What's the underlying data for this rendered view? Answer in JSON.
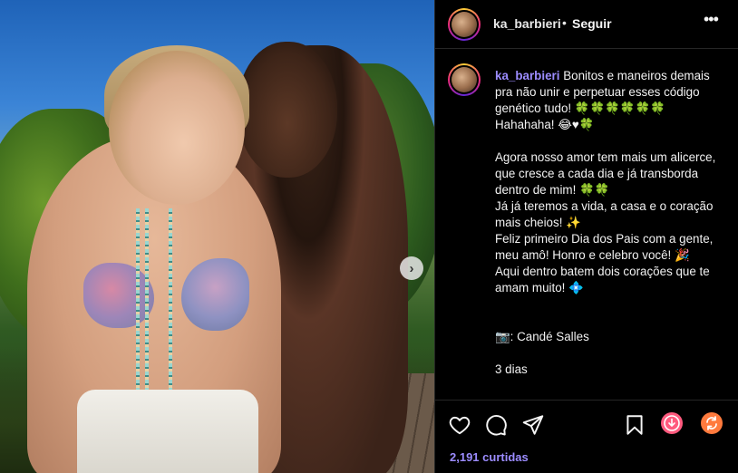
{
  "post": {
    "username": "ka_barbieri",
    "separator": "•",
    "follow_label": "Seguir",
    "more_label": "•••"
  },
  "caption": {
    "username": "ka_barbieri",
    "text": " Bonitos e maneiros demais pra não unir e perpetuar esses código genético tudo! 🍀🍀🍀🍀🍀🍀 Hahahaha! 😂♥🍀\n\nAgora nosso amor tem mais um alicerce, que cresce a cada dia e já transborda dentro de mim! 🍀🍀\nJá já teremos a vida, a casa e o coração mais cheios! ✨\nFeliz primeiro Dia dos Pais com a gente, meu amô! Honro e celebro você! 🎉\nAqui dentro batem dois corações que te amam muito! 💠\n\n\n📷: Candé Salles\n\n3 dias"
  },
  "media": {
    "next_button": "›"
  },
  "actions": {
    "icons": [
      "heart-icon",
      "comment-icon",
      "share-icon",
      "bookmark-icon",
      "download-icon",
      "repost-icon"
    ]
  },
  "likes": {
    "text": "2,191 curtidas"
  },
  "colors": {
    "accent_username": "#9c8cff",
    "background": "#000000",
    "divider": "#262626"
  }
}
